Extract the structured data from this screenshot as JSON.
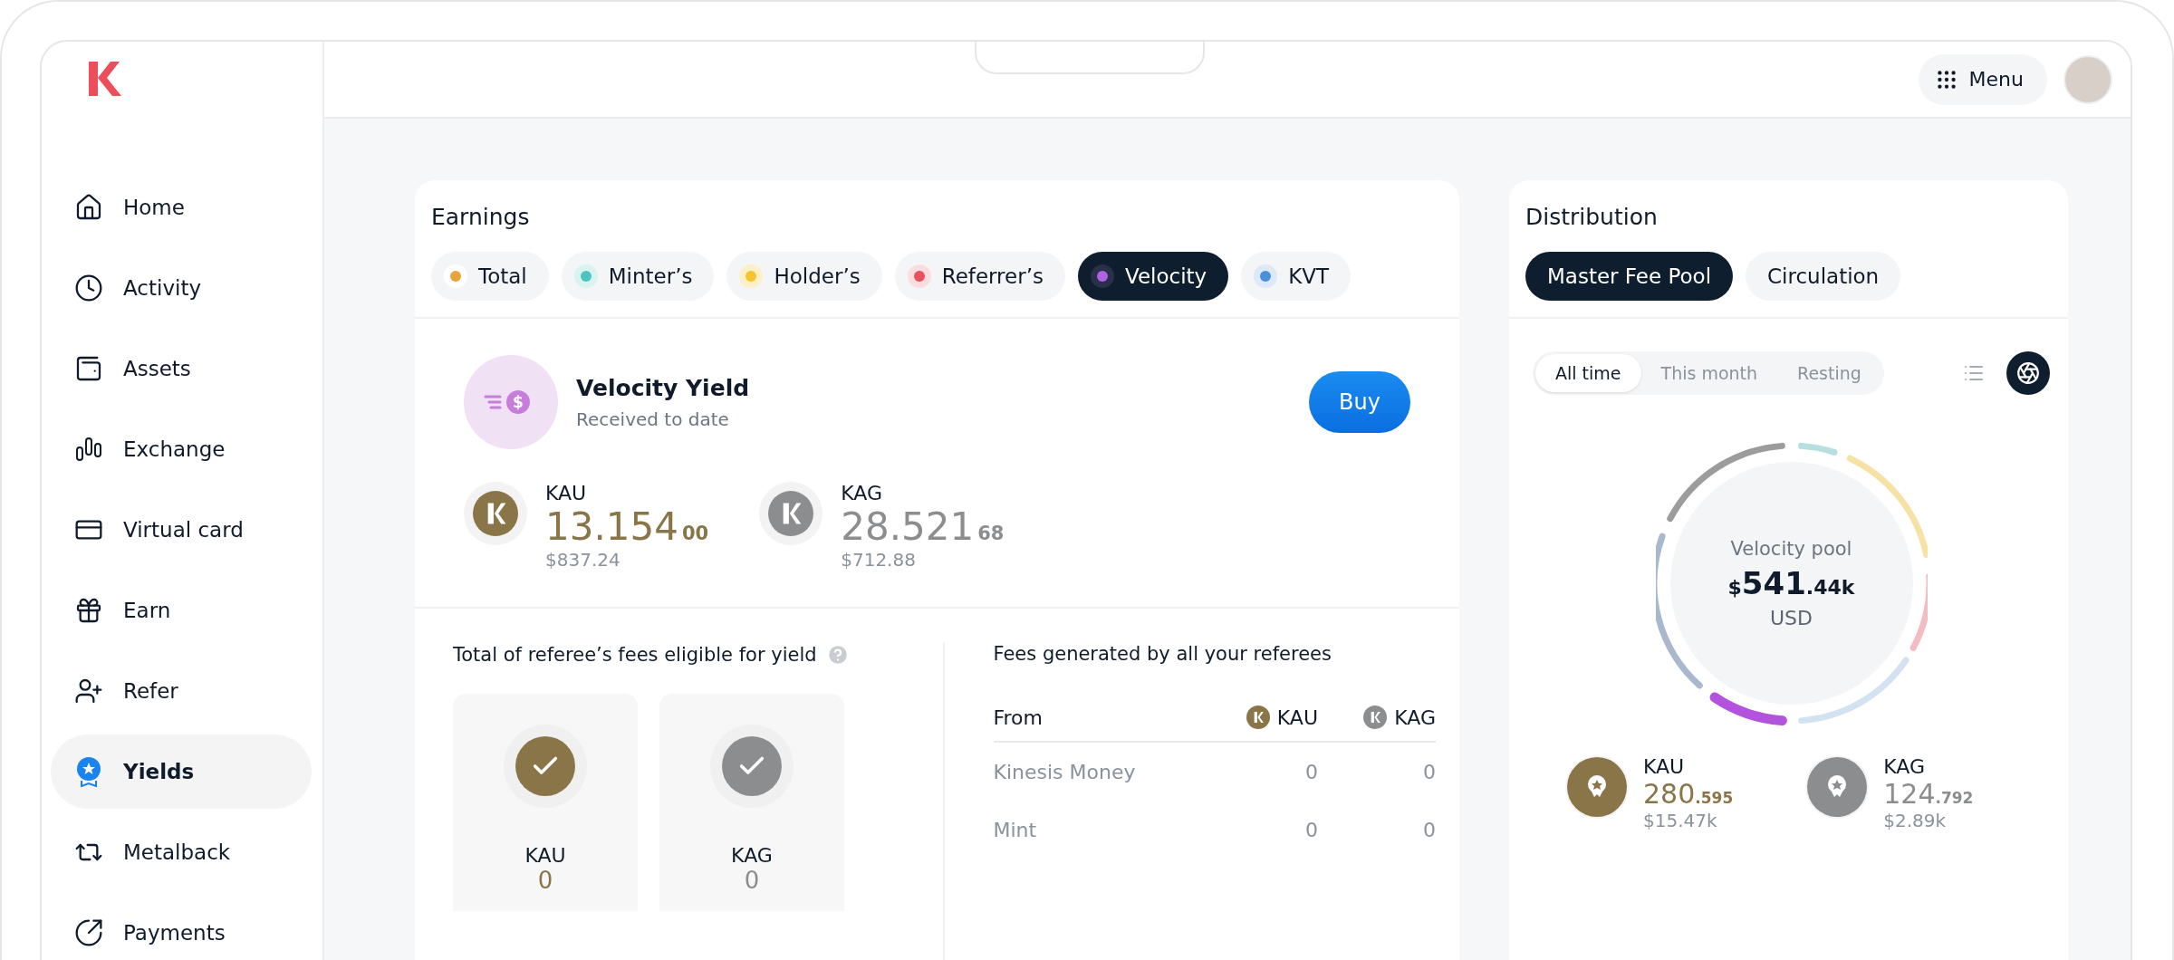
{
  "sidebar": {
    "items": [
      {
        "label": "Home",
        "selected": false
      },
      {
        "label": "Activity",
        "selected": false
      },
      {
        "label": "Assets",
        "selected": false
      },
      {
        "label": "Exchange",
        "selected": false
      },
      {
        "label": "Virtual card",
        "selected": false
      },
      {
        "label": "Earn",
        "selected": false
      },
      {
        "label": "Refer",
        "selected": false
      },
      {
        "label": "Yields",
        "selected": true
      },
      {
        "label": "Metalback",
        "selected": false
      },
      {
        "label": "Payments",
        "selected": false
      }
    ]
  },
  "topbar": {
    "menu": "Menu"
  },
  "earnings": {
    "title": "Earnings",
    "tabs": [
      {
        "label": "Total",
        "selected": false
      },
      {
        "label": "Minter’s",
        "selected": false
      },
      {
        "label": "Holder’s",
        "selected": false
      },
      {
        "label": "Referrer’s",
        "selected": false
      },
      {
        "label": "Velocity",
        "selected": true
      },
      {
        "label": "KVT",
        "selected": false
      }
    ],
    "yield": {
      "icon_symbol": "$",
      "title": "Velocity Yield",
      "subtitle": "Received to date",
      "button": "Buy"
    },
    "assets": [
      {
        "kind": "gold",
        "symbol": "KAU",
        "whole": "13.154",
        "fraction": "00",
        "usd": "$837.24"
      },
      {
        "kind": "silver",
        "symbol": "KAG",
        "whole": "28.521",
        "fraction": "68",
        "usd": "$712.88"
      }
    ],
    "eligible": {
      "title": "Total of referee’s fees eligible for yield",
      "cards": [
        {
          "kind": "gold",
          "symbol": "KAU",
          "value": "0"
        },
        {
          "kind": "silver",
          "symbol": "KAG",
          "value": "0"
        }
      ]
    },
    "fees": {
      "title": "Fees generated by all your referees",
      "columns": [
        {
          "label": "From"
        },
        {
          "label": "KAU",
          "kind": "gold"
        },
        {
          "label": "KAG",
          "kind": "silver"
        }
      ],
      "rows": [
        {
          "from": "Kinesis Money",
          "kau": "0",
          "kag": "0"
        },
        {
          "from": "Mint",
          "kau": "0",
          "kag": "0"
        }
      ]
    }
  },
  "distribution": {
    "title": "Distribution",
    "tabs": [
      {
        "label": "Master Fee Pool",
        "selected": true
      },
      {
        "label": "Circulation",
        "selected": false
      }
    ],
    "periods": [
      {
        "label": "All time",
        "selected": true
      },
      {
        "label": "This month",
        "selected": false
      },
      {
        "label": "Resting",
        "selected": false
      }
    ],
    "views": [
      {
        "kind": "list",
        "selected": false
      },
      {
        "kind": "chart",
        "selected": true
      }
    ],
    "pool": {
      "label": "Velocity pool",
      "currency": "$",
      "whole": "541",
      "fraction": ".44k",
      "unit": "USD"
    },
    "totals": [
      {
        "kind": "gold",
        "symbol": "KAU",
        "whole": "280",
        "fraction": ".595",
        "usd": "$15.47k"
      },
      {
        "kind": "silver",
        "symbol": "KAG",
        "whole": "124",
        "fraction": ".792",
        "usd": "$2.89k"
      }
    ]
  }
}
